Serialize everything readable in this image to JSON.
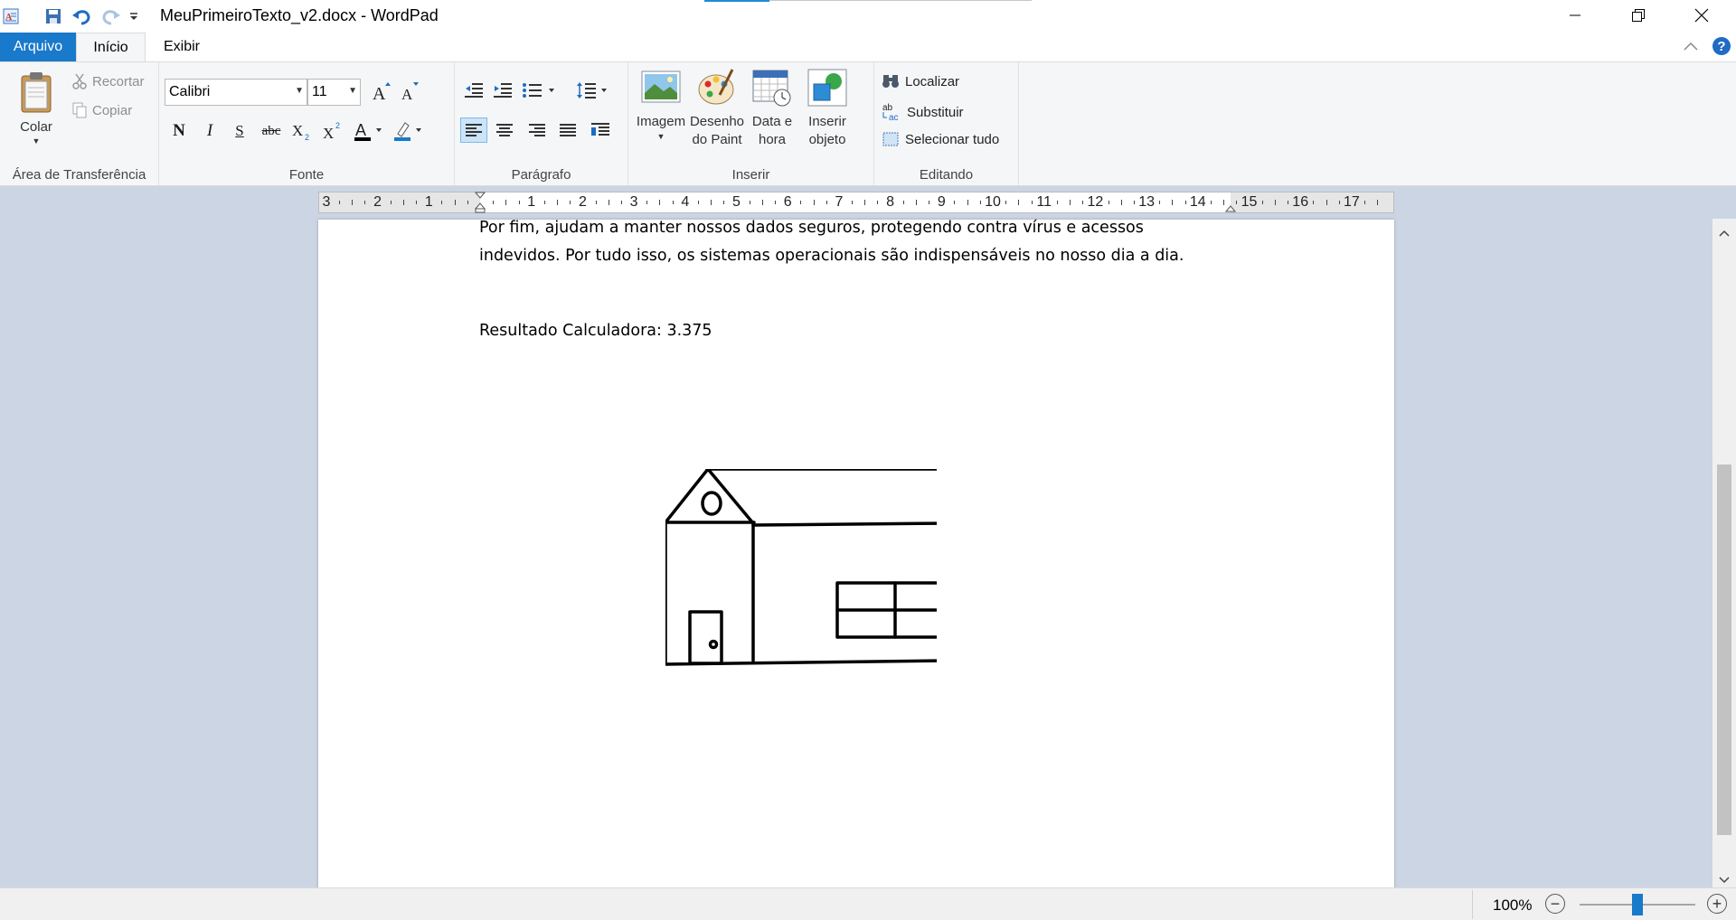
{
  "window": {
    "title": "MeuPrimeiroTexto_v2.docx - WordPad"
  },
  "quick_access": {
    "items": [
      "app-icon",
      "save-icon",
      "undo-icon",
      "redo-icon",
      "customize-dropdown-icon"
    ]
  },
  "tabs": {
    "file": "Arquivo",
    "home": "Início",
    "view": "Exibir"
  },
  "ribbon": {
    "clipboard": {
      "label": "Área de Transferência",
      "paste": "Colar",
      "cut": "Recortar",
      "copy": "Copiar"
    },
    "font": {
      "label": "Fonte",
      "family": "Calibri",
      "size": "11",
      "bold": "N",
      "italic": "I",
      "underline": "S",
      "strike": "abc"
    },
    "paragraph": {
      "label": "Parágrafo"
    },
    "insert": {
      "label": "Inserir",
      "image_line1": "Imagem",
      "paint_line1": "Desenho",
      "paint_line2": "do Paint",
      "datetime_line1": "Data e",
      "datetime_line2": "hora",
      "object_line1": "Inserir",
      "object_line2": "objeto"
    },
    "editing": {
      "label": "Editando",
      "find": "Localizar",
      "replace": "Substituir",
      "select_all": "Selecionar tudo"
    }
  },
  "ruler": {
    "numbers": [
      "3",
      "2",
      "1",
      "1",
      "2",
      "3",
      "4",
      "5",
      "6",
      "7",
      "8",
      "9",
      "10",
      "11",
      "12",
      "13",
      "14",
      "15",
      "16",
      "17"
    ]
  },
  "document": {
    "line1": "Por fim, ajudam a manter nossos dados seguros, protegendo contra vírus e acessos",
    "line2": "indevidos. Por tudo isso, os sistemas operacionais são indispensáveis no nosso dia a dia.",
    "line3": "Resultado Calculadora: 3.375",
    "drawing_name": "house-drawing"
  },
  "status": {
    "zoom": "100%",
    "zoom_out": "−",
    "zoom_in": "+",
    "zoom_level": 0.5
  },
  "colors": {
    "accent": "#1979ca",
    "workspace": "#ccd5e4",
    "ribbon": "#f5f6f7",
    "font_color": "#000000",
    "highlight": "#1979ca"
  }
}
